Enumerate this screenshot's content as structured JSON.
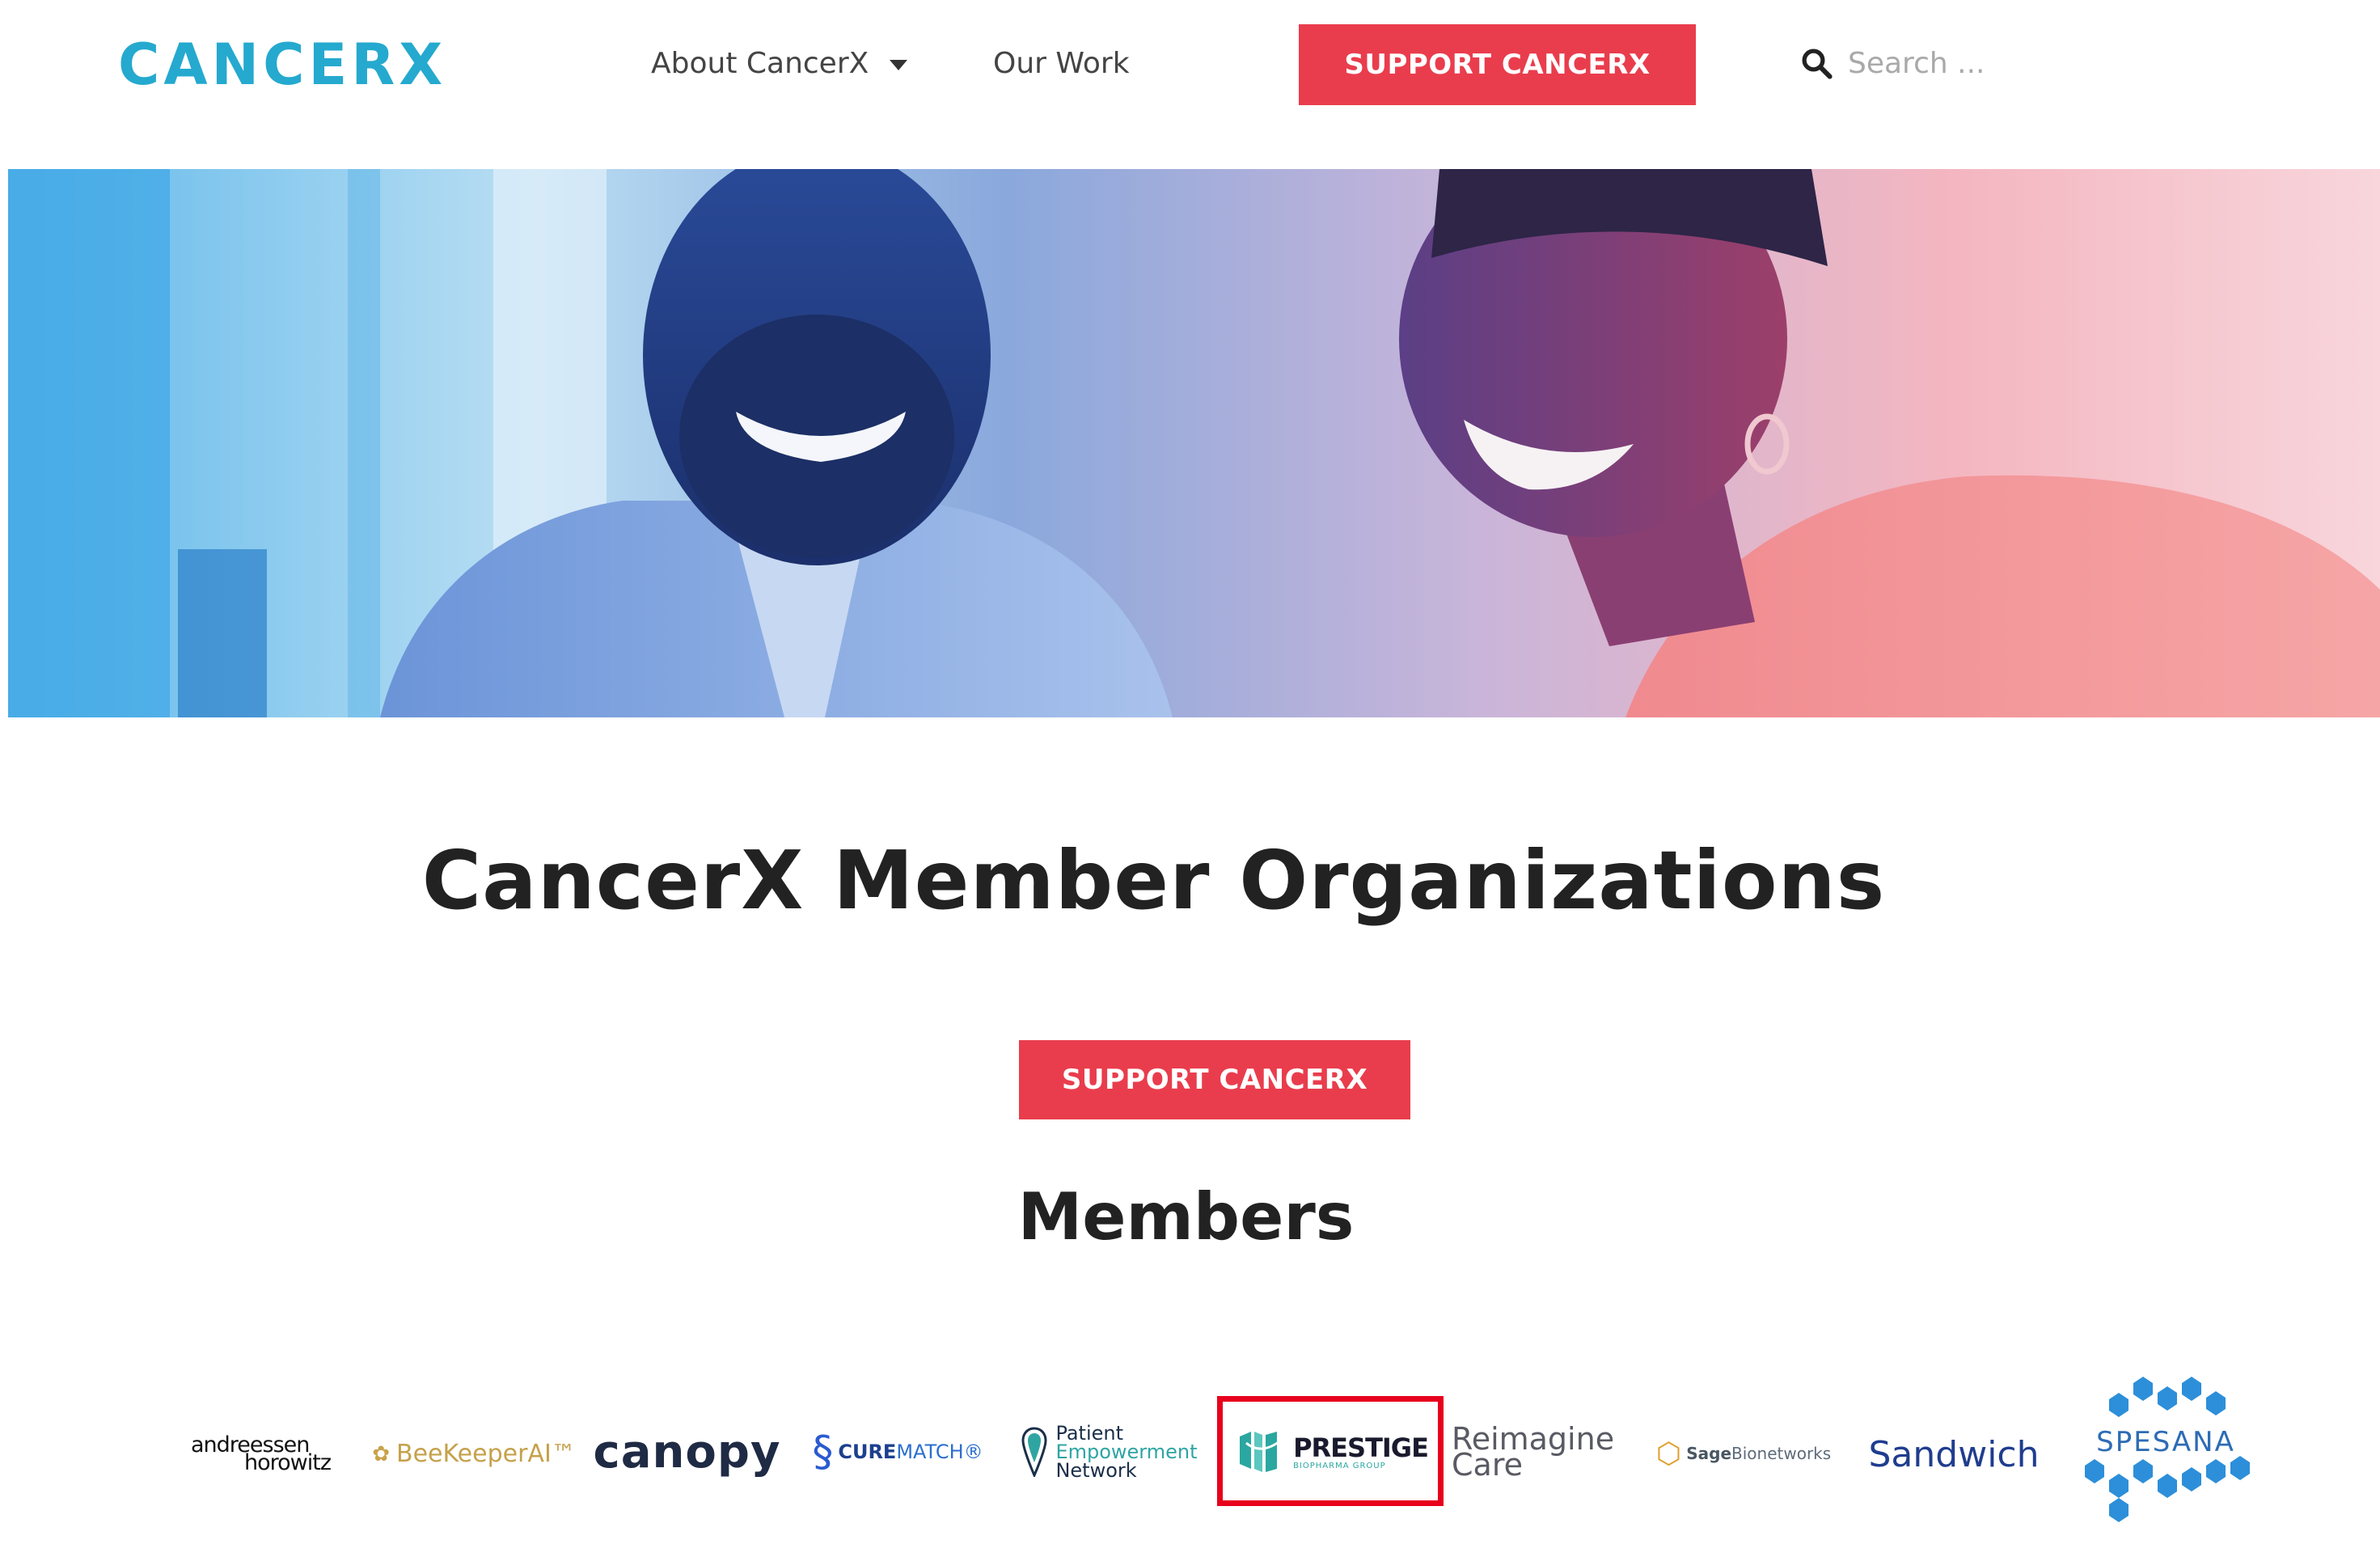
{
  "header": {
    "logo_text": "CANCERX",
    "nav": [
      {
        "label": "About CancerX",
        "has_dropdown": true
      },
      {
        "label": "Our Work",
        "has_dropdown": false
      }
    ],
    "cta_label": "SUPPORT CANCERX",
    "search_placeholder": "Search ..."
  },
  "main": {
    "title": "CancerX Member Organizations",
    "cta_label": "SUPPORT CANCERX",
    "members_heading": "Members",
    "members": [
      {
        "name": "andreessen horowitz",
        "line1": "andreessen",
        "line2": "horowitz"
      },
      {
        "name": "BeeKeeperAI",
        "text": "BeeKeeperAI™"
      },
      {
        "name": "canopy",
        "text": "canopy"
      },
      {
        "name": "CureMatch",
        "bold": "CURE",
        "light": "MATCH®"
      },
      {
        "name": "Patient Empowerment Network",
        "lines": [
          "Patient",
          "Empowerment",
          "Network"
        ]
      },
      {
        "name": "Prestige Biopharma Group",
        "big": "PRESTIGE",
        "small": "BIOPHARMA GROUP",
        "highlighted": true
      },
      {
        "name": "Reimagine Care",
        "line1": "Reimagine",
        "line2": "Care"
      },
      {
        "name": "Sage Bionetworks",
        "bold": "Sage",
        "light": "Bionetworks"
      },
      {
        "name": "Sandwich",
        "text": "Sandwich"
      },
      {
        "name": "Spesana",
        "text": "SPESANA"
      }
    ]
  },
  "colors": {
    "brand_red": "#e93d4d",
    "brand_blue": "#25a9cf",
    "highlight_box": "#e8001c"
  },
  "icons": {
    "search": "search-icon",
    "dropdown": "chevron-down-icon"
  }
}
